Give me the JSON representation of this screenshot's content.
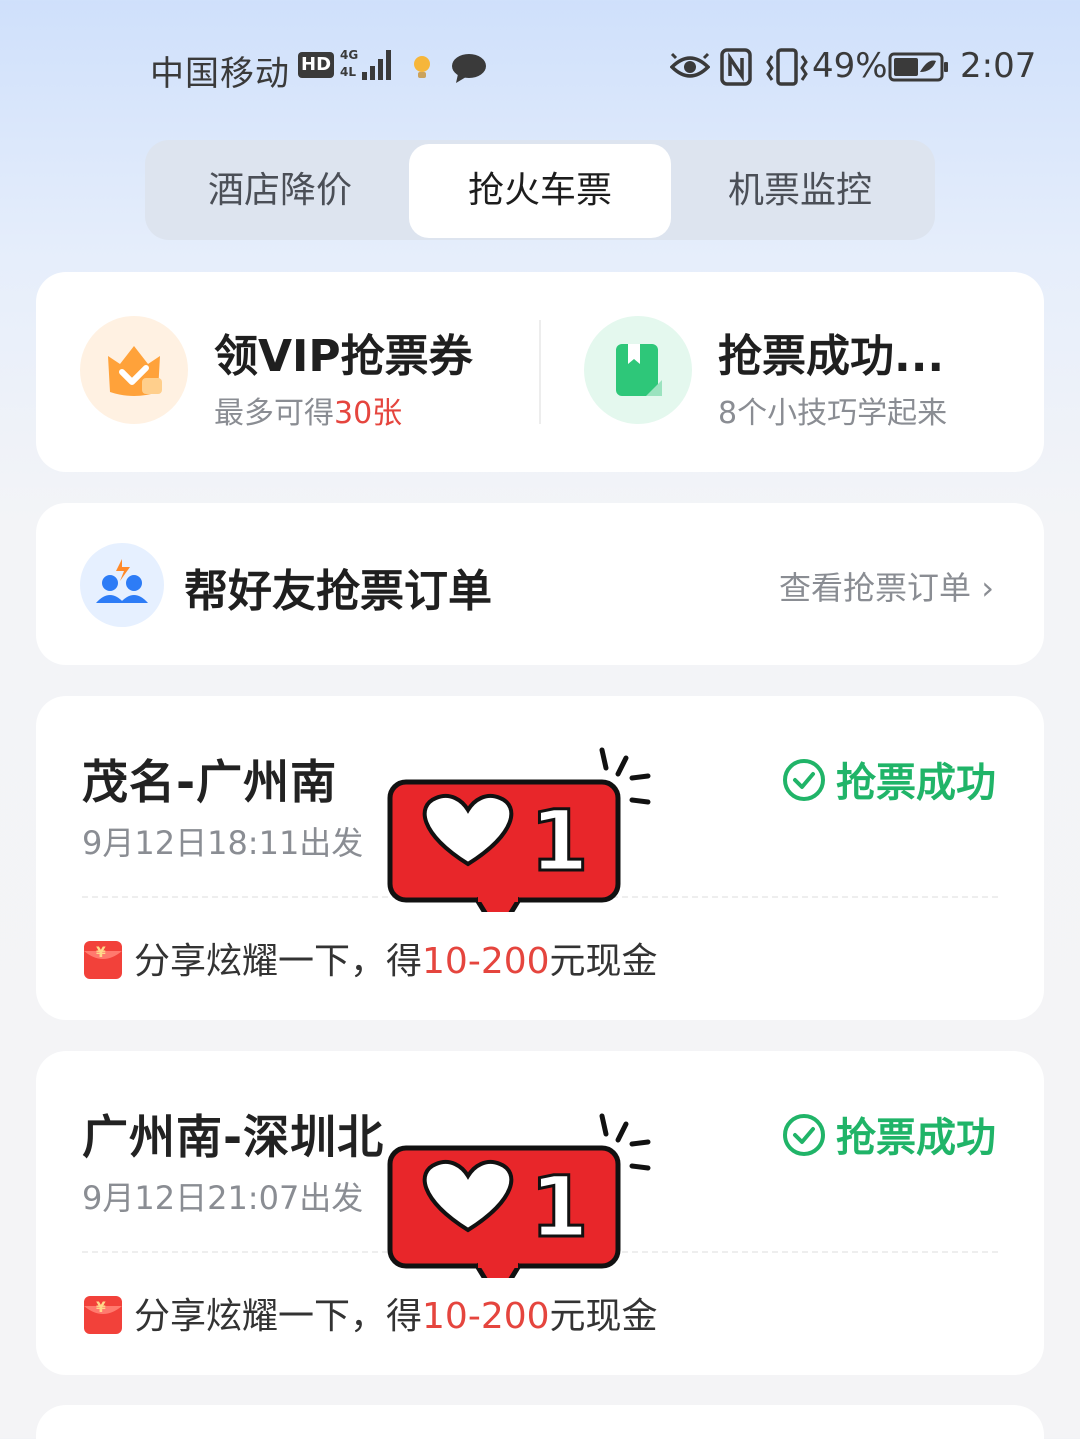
{
  "status_bar": {
    "carrier": "中国移动",
    "hd": "HD",
    "battery_percent": "49%",
    "time": "2:07",
    "icons": [
      "signal-icon",
      "bulb-icon",
      "chat-icon",
      "eye-icon",
      "nfc-icon",
      "vibrate-icon",
      "battery-icon"
    ]
  },
  "tabs": [
    {
      "label": "酒店降价",
      "selected": false
    },
    {
      "label": "抢火车票",
      "selected": true
    },
    {
      "label": "机票监控",
      "selected": false
    }
  ],
  "promo": {
    "left": {
      "title": "领VIP抢票券",
      "sub_prefix": "最多可得",
      "sub_highlight": "30张"
    },
    "right": {
      "title": "抢票成功...",
      "sub": "8个小技巧学起来"
    }
  },
  "friend": {
    "title": "帮好友抢票订单",
    "link": "查看抢票订单 ›"
  },
  "orders": [
    {
      "route": "茂名-广州南",
      "date": "9月12日18:11出发",
      "status": "抢票成功",
      "share_prefix": "分享炫耀一下，得",
      "share_highlight": "10-200",
      "share_suffix": "元现金"
    },
    {
      "route": "广州南-深圳北",
      "date": "9月12日21:07出发",
      "status": "抢票成功",
      "share_prefix": "分享炫耀一下，得",
      "share_highlight": "10-200",
      "share_suffix": "元现金"
    }
  ],
  "like_sticker": {
    "count": "1"
  },
  "colors": {
    "accent_green": "#20b468",
    "highlight_red": "#e5453e",
    "sticker_red": "#e8262a"
  }
}
